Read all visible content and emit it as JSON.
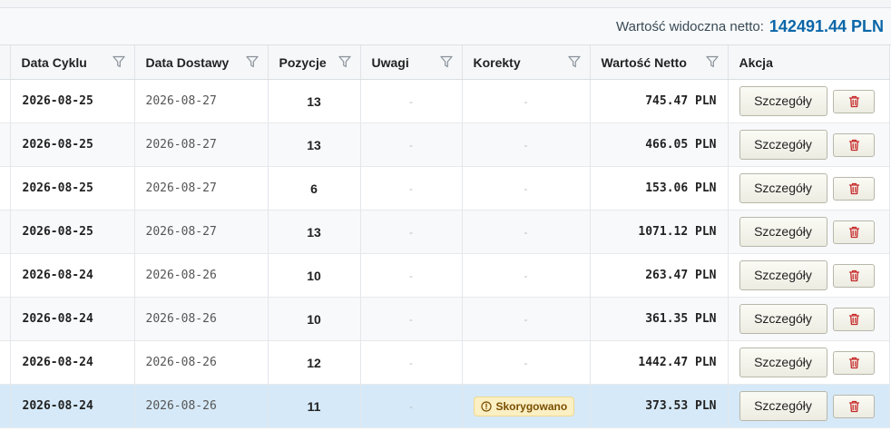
{
  "summary": {
    "label": "Wartość widoczna netto:",
    "value": "142491.44 PLN"
  },
  "columns": [
    {
      "label": "Data Cyklu",
      "filter": true
    },
    {
      "label": "Data Dostawy",
      "filter": true
    },
    {
      "label": "Pozycje",
      "filter": true
    },
    {
      "label": "Uwagi",
      "filter": true
    },
    {
      "label": "Korekty",
      "filter": true
    },
    {
      "label": "Wartość Netto",
      "filter": true
    },
    {
      "label": "Akcja",
      "filter": false
    }
  ],
  "empty_placeholder": "-",
  "details_label": "Szczegóły",
  "colors": {
    "accent": "#0b66a8",
    "selected_row": "#d6e9f8",
    "delete_icon": "#c62828",
    "badge_bg": "#fbefc4"
  },
  "rows": [
    {
      "cycle": "2026-08-25",
      "delivery": "2026-08-27",
      "items": "13",
      "notes": "-",
      "corrections": "-",
      "net": "745.47 PLN",
      "selected": false
    },
    {
      "cycle": "2026-08-25",
      "delivery": "2026-08-27",
      "items": "13",
      "notes": "-",
      "corrections": "-",
      "net": "466.05 PLN",
      "selected": false
    },
    {
      "cycle": "2026-08-25",
      "delivery": "2026-08-27",
      "items": "6",
      "notes": "-",
      "corrections": "-",
      "net": "153.06 PLN",
      "selected": false
    },
    {
      "cycle": "2026-08-25",
      "delivery": "2026-08-27",
      "items": "13",
      "notes": "-",
      "corrections": "-",
      "net": "1071.12 PLN",
      "selected": false
    },
    {
      "cycle": "2026-08-24",
      "delivery": "2026-08-26",
      "items": "10",
      "notes": "-",
      "corrections": "-",
      "net": "263.47 PLN",
      "selected": false
    },
    {
      "cycle": "2026-08-24",
      "delivery": "2026-08-26",
      "items": "10",
      "notes": "-",
      "corrections": "-",
      "net": "361.35 PLN",
      "selected": false
    },
    {
      "cycle": "2026-08-24",
      "delivery": "2026-08-26",
      "items": "12",
      "notes": "-",
      "corrections": "-",
      "net": "1442.47 PLN",
      "selected": false
    },
    {
      "cycle": "2026-08-24",
      "delivery": "2026-08-26",
      "items": "11",
      "notes": "-",
      "corrections": "Skorygowano",
      "corrections_badge": true,
      "net": "373.53 PLN",
      "selected": true
    }
  ]
}
